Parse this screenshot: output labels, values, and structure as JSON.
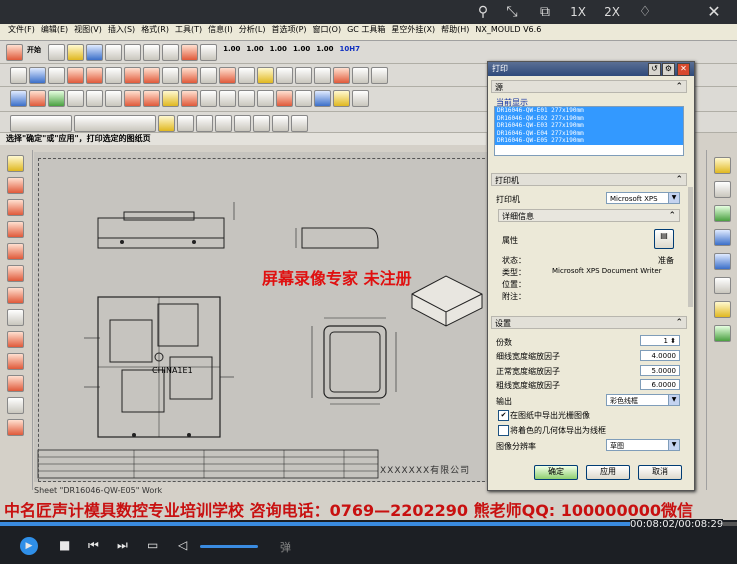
{
  "player": {
    "speed_1x": "1X",
    "speed_2x": "2X",
    "time": "00:08:02/00:08:29",
    "progress": 0.946,
    "danmu_label": "弹",
    "banner": "中名匠声计模具数控专业培训学校 咨询电话：0769—2202290 熊老师QQ: 100000000微信"
  },
  "menu": {
    "items": [
      "文件(F)",
      "编辑(E)",
      "视图(V)",
      "插入(S)",
      "格式(R)",
      "工具(T)",
      "信息(I)",
      "分析(L)",
      "首选项(P)",
      "窗口(O)",
      "GC 工具箱",
      "星空外挂(X)",
      "帮助(H)",
      "NX_MOULD V6.6"
    ]
  },
  "toolbar": {
    "start_label": "开始",
    "values": [
      "1.00",
      "1.00",
      "1.00",
      "1.00",
      "1.00",
      "10H7"
    ]
  },
  "prompt": "选择\"确定\"或\"应用\"，打印选定的图纸页",
  "drawing": {
    "watermark": "屏幕录像专家  未注册",
    "company": "XXXXXXX有限公司",
    "sheet_label": "Sheet \"DR16046-QW-E05\" Work",
    "part_label": "CHINA1E1"
  },
  "dialog": {
    "title": "打印",
    "source": {
      "header": "源",
      "list_title": "当前显示",
      "items": [
        "DR16046-QW-E01  277x190mm",
        "DR16046-QW-E02  277x190mm",
        "DR16046-QW-E03  277x190mm",
        "DR16046-QW-E04  277x190mm",
        "DR16046-QW-E05  277x190mm"
      ]
    },
    "printer": {
      "header": "打印机",
      "label": "打印机",
      "value": "Microsoft XPS",
      "details_header": "详细信息",
      "properties": "属性",
      "status_label": "状态：",
      "status_value": "准备",
      "type_label": "类型：",
      "type_value": "Microsoft XPS Document Writer",
      "where_label": "位置：",
      "comment_label": "附注："
    },
    "settings": {
      "header": "设置",
      "copies_label": "份数",
      "copies": "1",
      "thin_label": "细线宽度缩放因子",
      "thin": "4.0000",
      "normal_label": "正常宽度缩放因子",
      "normal": "5.0000",
      "thick_label": "粗线宽度缩放因子",
      "thick": "6.0000",
      "output_label": "输出",
      "output": "彩色线框",
      "raster_label": "在图纸中导出光栅图像",
      "raster_checked": true,
      "black_label": "将着色的几何体导出为线框",
      "black_checked": false,
      "resolution_label": "图像分辨率",
      "resolution": "草图"
    },
    "buttons": {
      "ok": "确定",
      "apply": "应用",
      "cancel": "取消"
    }
  }
}
